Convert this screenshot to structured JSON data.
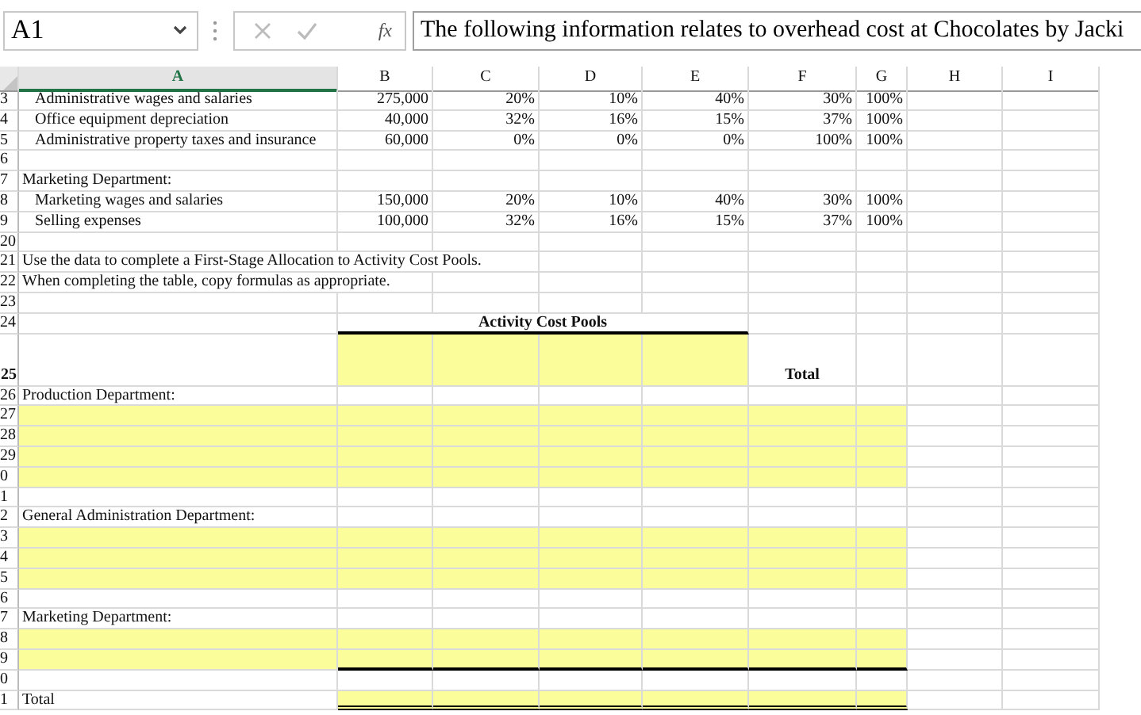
{
  "formula_bar": {
    "cell_ref": "A1",
    "function_label": "fx",
    "formula": "The following information relates to overhead cost at Chocolates by Jacki"
  },
  "columns": [
    {
      "label": "A",
      "selected": true
    },
    {
      "label": "B",
      "selected": false
    },
    {
      "label": "C",
      "selected": false
    },
    {
      "label": "D",
      "selected": false
    },
    {
      "label": "E",
      "selected": false
    },
    {
      "label": "F",
      "selected": false
    },
    {
      "label": "G",
      "selected": false
    },
    {
      "label": "H",
      "selected": false
    },
    {
      "label": "I",
      "selected": false
    }
  ],
  "rows": [
    {
      "number": "3",
      "kind": "item",
      "cells": [
        {
          "text": "Administrative wages and salaries"
        },
        {
          "text": "275,000"
        },
        {
          "text": "20%"
        },
        {
          "text": "10%"
        },
        {
          "text": "40%"
        },
        {
          "text": "30%"
        },
        {
          "text": "100%"
        }
      ]
    },
    {
      "number": "4",
      "kind": "item",
      "cells": [
        {
          "text": "Office equipment depreciation"
        },
        {
          "text": "40,000"
        },
        {
          "text": "32%"
        },
        {
          "text": "16%"
        },
        {
          "text": "15%"
        },
        {
          "text": "37%"
        },
        {
          "text": "100%"
        }
      ]
    },
    {
      "number": "5",
      "kind": "item",
      "cells": [
        {
          "text": "Administrative property taxes and insurance"
        },
        {
          "text": "60,000"
        },
        {
          "text": "0%"
        },
        {
          "text": "0%"
        },
        {
          "text": "0%"
        },
        {
          "text": "100%"
        },
        {
          "text": "100%"
        }
      ]
    },
    {
      "number": "6",
      "kind": "plain",
      "cells": []
    },
    {
      "number": "7",
      "kind": "plain",
      "cells": [
        {
          "text": "Marketing Department:"
        }
      ]
    },
    {
      "number": "8",
      "kind": "item",
      "cells": [
        {
          "text": "Marketing wages and salaries"
        },
        {
          "text": "150,000"
        },
        {
          "text": "20%"
        },
        {
          "text": "10%"
        },
        {
          "text": "40%"
        },
        {
          "text": "30%"
        },
        {
          "text": "100%"
        }
      ]
    },
    {
      "number": "9",
      "kind": "item",
      "cells": [
        {
          "text": "Selling expenses"
        },
        {
          "text": "100,000"
        },
        {
          "text": "32%"
        },
        {
          "text": "16%"
        },
        {
          "text": "15%"
        },
        {
          "text": "37%"
        },
        {
          "text": "100%"
        }
      ]
    },
    {
      "number": "20",
      "kind": "plain",
      "cells": []
    },
    {
      "number": "21",
      "kind": "plain",
      "cells": [
        {
          "text": "Use the data to complete a First-Stage Allocation to Activity Cost Pools."
        }
      ]
    },
    {
      "number": "22",
      "kind": "plain",
      "cells": [
        {
          "text": "When completing the table, copy formulas as appropriate."
        }
      ]
    },
    {
      "number": "23",
      "kind": "plain",
      "cells": []
    },
    {
      "number": "24",
      "kind": "caption",
      "cells": [
        {},
        {
          "text": "Activity Cost Pools",
          "thick_border_below": true
        },
        {
          "merged": true
        },
        {
          "merged": true
        },
        {
          "merged": true
        }
      ]
    },
    {
      "number": "25",
      "kind": "header",
      "cells": [
        {},
        {
          "highlighted": true
        },
        {
          "highlighted": true
        },
        {
          "highlighted": true
        },
        {
          "highlighted": true
        },
        {
          "text": "Total"
        }
      ]
    },
    {
      "number": "26",
      "kind": "plain",
      "cells": [
        {
          "text": "Production Department:"
        }
      ]
    },
    {
      "number": "27",
      "kind": "plain",
      "cells": [
        {
          "highlighted": true
        },
        {
          "highlighted": true
        },
        {
          "highlighted": true
        },
        {
          "highlighted": true
        },
        {
          "highlighted": true
        },
        {
          "highlighted": true
        },
        {
          "highlighted": true
        }
      ]
    },
    {
      "number": "28",
      "kind": "plain",
      "cells": [
        {
          "highlighted": true
        },
        {
          "highlighted": true
        },
        {
          "highlighted": true
        },
        {
          "highlighted": true
        },
        {
          "highlighted": true
        },
        {
          "highlighted": true
        },
        {
          "highlighted": true
        }
      ]
    },
    {
      "number": "29",
      "kind": "plain",
      "cells": [
        {
          "highlighted": true
        },
        {
          "highlighted": true
        },
        {
          "highlighted": true
        },
        {
          "highlighted": true
        },
        {
          "highlighted": true
        },
        {
          "highlighted": true
        },
        {
          "highlighted": true
        }
      ]
    },
    {
      "number": "0",
      "kind": "plain",
      "cells": [
        {
          "highlighted": true
        },
        {
          "highlighted": true
        },
        {
          "highlighted": true
        },
        {
          "highlighted": true
        },
        {
          "highlighted": true
        },
        {
          "highlighted": true
        },
        {
          "highlighted": true
        }
      ]
    },
    {
      "number": "1",
      "kind": "plain",
      "cells": []
    },
    {
      "number": "2",
      "kind": "plain",
      "cells": [
        {
          "text": "General Administration Department:"
        }
      ]
    },
    {
      "number": "3",
      "kind": "plain",
      "cells": [
        {
          "highlighted": true
        },
        {
          "highlighted": true
        },
        {
          "highlighted": true
        },
        {
          "highlighted": true
        },
        {
          "highlighted": true
        },
        {
          "highlighted": true
        },
        {
          "highlighted": true
        }
      ]
    },
    {
      "number": "4",
      "kind": "plain",
      "cells": [
        {
          "highlighted": true
        },
        {
          "highlighted": true
        },
        {
          "highlighted": true
        },
        {
          "highlighted": true
        },
        {
          "highlighted": true
        },
        {
          "highlighted": true
        },
        {
          "highlighted": true
        }
      ]
    },
    {
      "number": "5",
      "kind": "plain",
      "cells": [
        {
          "highlighted": true
        },
        {
          "highlighted": true
        },
        {
          "highlighted": true
        },
        {
          "highlighted": true
        },
        {
          "highlighted": true
        },
        {
          "highlighted": true
        },
        {
          "highlighted": true
        }
      ]
    },
    {
      "number": "6",
      "kind": "plain",
      "cells": []
    },
    {
      "number": "7",
      "kind": "plain",
      "cells": [
        {
          "text": "Marketing Department:"
        }
      ]
    },
    {
      "number": "8",
      "kind": "plain",
      "cells": [
        {
          "highlighted": true
        },
        {
          "highlighted": true
        },
        {
          "highlighted": true
        },
        {
          "highlighted": true
        },
        {
          "highlighted": true
        },
        {
          "highlighted": true
        },
        {
          "highlighted": true
        }
      ]
    },
    {
      "number": "9",
      "kind": "plain",
      "cells": [
        {
          "highlighted": true
        },
        {
          "highlighted": true,
          "thick_border_below": true
        },
        {
          "highlighted": true,
          "thick_border_below": true
        },
        {
          "highlighted": true,
          "thick_border_below": true
        },
        {
          "highlighted": true,
          "thick_border_below": true
        },
        {
          "highlighted": true,
          "thick_border_below": true
        },
        {
          "highlighted": true,
          "thick_border_below": true
        }
      ]
    },
    {
      "number": "0",
      "kind": "plain",
      "cells": []
    },
    {
      "number": "1",
      "kind": "plain",
      "cells": [
        {
          "text": "Total"
        },
        {
          "highlighted": true,
          "double_border_below": true
        },
        {
          "highlighted": true,
          "double_border_below": true
        },
        {
          "highlighted": true,
          "double_border_below": true
        },
        {
          "highlighted": true,
          "double_border_below": true
        },
        {
          "highlighted": true,
          "double_border_below": true
        },
        {
          "highlighted": true,
          "double_border_below": true
        }
      ]
    }
  ]
}
